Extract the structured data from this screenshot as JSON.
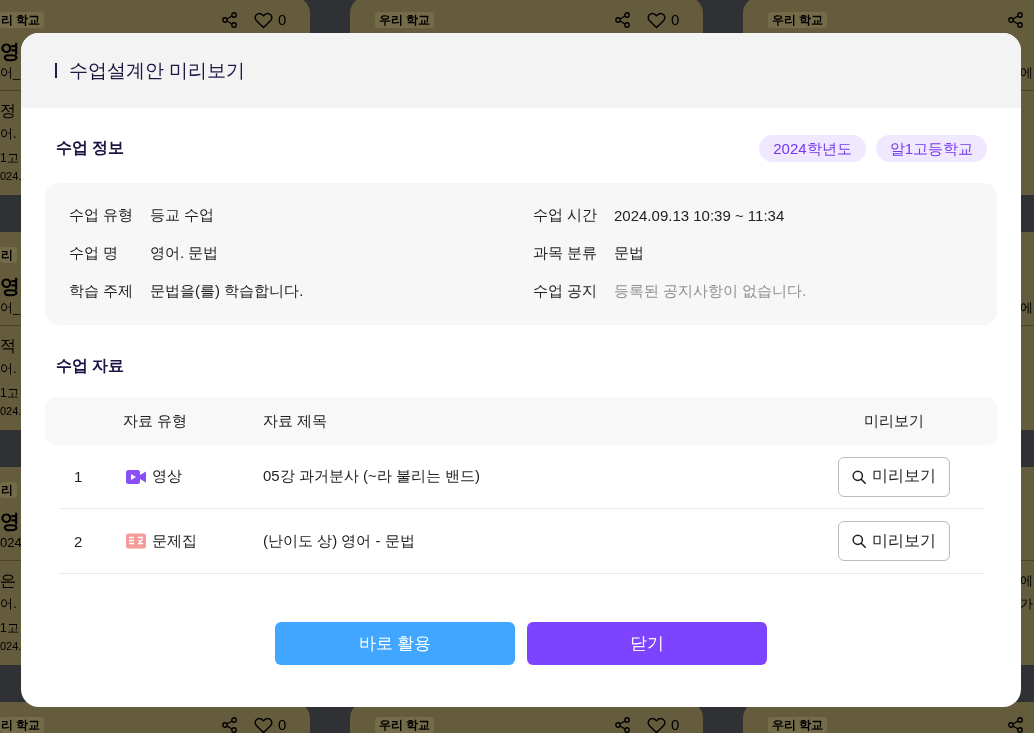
{
  "background": {
    "card_rows": [
      {
        "left": {
          "tag": "리 학교",
          "likes": "0",
          "title": "영",
          "subtitle": "어_",
          "lines": [
            "정",
            "어.",
            "1고",
            "024."
          ]
        },
        "middle": {
          "tag": "우리 학교",
          "likes": "0"
        },
        "right": {
          "tag": "우리 학교",
          "subtitle": "에"
        }
      },
      {
        "left": {
          "tag": "리",
          "title": "영",
          "subtitle": "어_",
          "lines": [
            "적",
            "어.",
            "1고",
            "024."
          ]
        },
        "right": {
          "subtitle": "에"
        }
      },
      {
        "left": {
          "tag": "리",
          "title": "영",
          "subtitle": "024",
          "lines": [
            "은",
            "어.",
            "1고",
            "024."
          ]
        },
        "right": {
          "lines": [
            "에",
            "가"
          ]
        }
      },
      {
        "left": {
          "tag": "리 학교",
          "likes": "0"
        },
        "middle": {
          "tag": "우리 학교",
          "likes": "0"
        },
        "right": {
          "tag": "우리 학교"
        }
      }
    ]
  },
  "modal": {
    "title": "수업설계안 미리보기",
    "info": {
      "heading": "수업 정보",
      "badges": [
        "2024학년도",
        "알1고등학교"
      ],
      "fields": [
        {
          "label": "수업 유형",
          "value": "등교 수업",
          "muted": false
        },
        {
          "label": "수업 시간",
          "value": "2024.09.13 10:39 ~ 11:34",
          "muted": false
        },
        {
          "label": "수업 명",
          "value": "영어. 문법",
          "muted": false
        },
        {
          "label": "과목 분류",
          "value": "문법",
          "muted": false
        },
        {
          "label": "학습 주제",
          "value": "문법을(를) 학습합니다.",
          "muted": false
        },
        {
          "label": "수업 공지",
          "value": "등록된 공지사항이 없습니다.",
          "muted": true
        }
      ]
    },
    "materials": {
      "heading": "수업 자료",
      "columns": [
        "자료 유형",
        "자료 제목",
        "미리보기"
      ],
      "rows": [
        {
          "number": "1",
          "kind": "video",
          "type": "영상",
          "title": "05강 과거분사 (~라 불리는 밴드)",
          "action": "미리보기"
        },
        {
          "number": "2",
          "kind": "workbook",
          "type": "문제집",
          "title": "(난이도 상) 영어 - 문법",
          "action": "미리보기"
        }
      ]
    },
    "buttons": [
      {
        "label": "바로 활용",
        "kind": "secondary"
      },
      {
        "label": "닫기",
        "kind": "primary"
      }
    ]
  }
}
